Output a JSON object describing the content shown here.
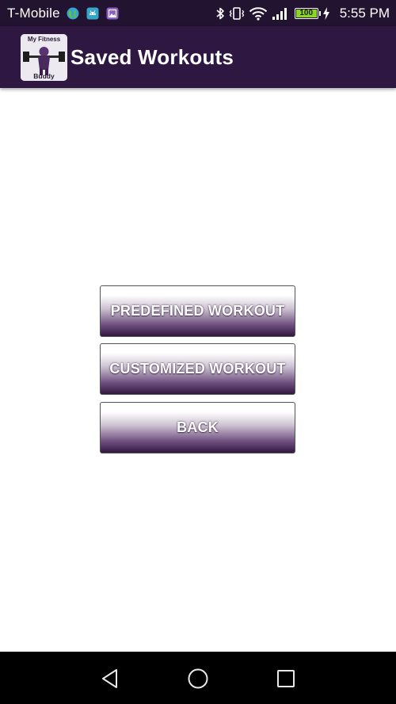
{
  "status_bar": {
    "carrier": "T-Mobile",
    "time": "5:55 PM",
    "battery_level": "100",
    "icons": [
      "globe-icon",
      "android-icon",
      "image-icon",
      "bluetooth-icon",
      "vibrate-icon",
      "wifi-icon",
      "cell-signal-icon",
      "battery-icon",
      "charging-icon"
    ]
  },
  "app_bar": {
    "logo_text_top": "My Fitness",
    "logo_text_bottom": "Buddy",
    "title": "Saved Workouts"
  },
  "menu": {
    "buttons": [
      {
        "label": "PREDEFINED WORKOUT"
      },
      {
        "label": "CUSTOMIZED WORKOUT"
      },
      {
        "label": "BACK"
      }
    ]
  },
  "nav_bar": {
    "icons": [
      "back-icon",
      "home-icon",
      "recents-icon"
    ]
  },
  "colors": {
    "status_bar": "#221330",
    "app_bar": "#2e1740",
    "button_dark": "#33173f",
    "battery_fill": "#8bd428"
  }
}
